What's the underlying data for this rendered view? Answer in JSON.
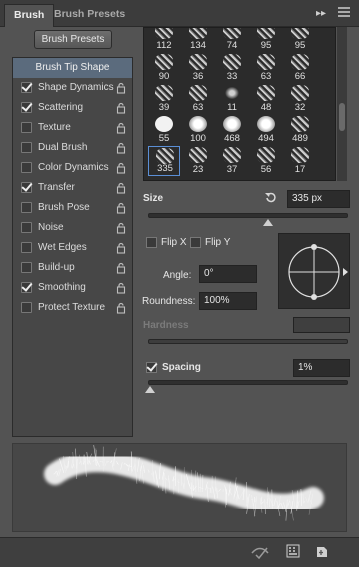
{
  "tabs": [
    {
      "label": "Brush",
      "active": true
    },
    {
      "label": "Brush Presets",
      "active": false
    }
  ],
  "panel_controls": {
    "collapse_icon": "double-chevron-right-icon",
    "menu_icon": "panel-menu-icon"
  },
  "presets_button": "Brush Presets",
  "options": [
    {
      "label": "Brush Tip Shape",
      "selected": true,
      "has_checkbox": false
    },
    {
      "label": "Shape Dynamics",
      "checked": true
    },
    {
      "label": "Scattering",
      "checked": true
    },
    {
      "label": "Texture",
      "checked": false
    },
    {
      "label": "Dual Brush",
      "checked": false
    },
    {
      "label": "Color Dynamics",
      "checked": false
    },
    {
      "label": "Transfer",
      "checked": true
    },
    {
      "label": "Brush Pose",
      "checked": false
    },
    {
      "label": "Noise",
      "checked": false
    },
    {
      "label": "Wet Edges",
      "checked": false
    },
    {
      "label": "Build-up",
      "checked": false
    },
    {
      "label": "Smoothing",
      "checked": true
    },
    {
      "label": "Protect Texture",
      "checked": false
    }
  ],
  "brush_grid": {
    "rows": [
      [
        "112",
        "134",
        "74",
        "95",
        "95"
      ],
      [
        "90",
        "36",
        "33",
        "63",
        "66"
      ],
      [
        "39",
        "63",
        "11",
        "48",
        "32"
      ],
      [
        "55",
        "100",
        "468",
        "494",
        "489"
      ],
      [
        "335",
        "23",
        "37",
        "56",
        "17"
      ]
    ],
    "selected": "335"
  },
  "size": {
    "label": "Size",
    "value": "335 px",
    "slider": 0.6
  },
  "flip_x": {
    "label": "Flip X",
    "checked": false
  },
  "flip_y": {
    "label": "Flip Y",
    "checked": false
  },
  "angle": {
    "label": "Angle:",
    "value": "0°"
  },
  "roundness": {
    "label": "Roundness:",
    "value": "100%"
  },
  "hardness": {
    "label": "Hardness",
    "value": ""
  },
  "spacing": {
    "label": "Spacing",
    "checked": true,
    "value": "1%",
    "slider": 0.01
  },
  "bottom_icons": [
    "brush-visibility-icon",
    "grid-toggle-icon",
    "new-preset-icon"
  ]
}
